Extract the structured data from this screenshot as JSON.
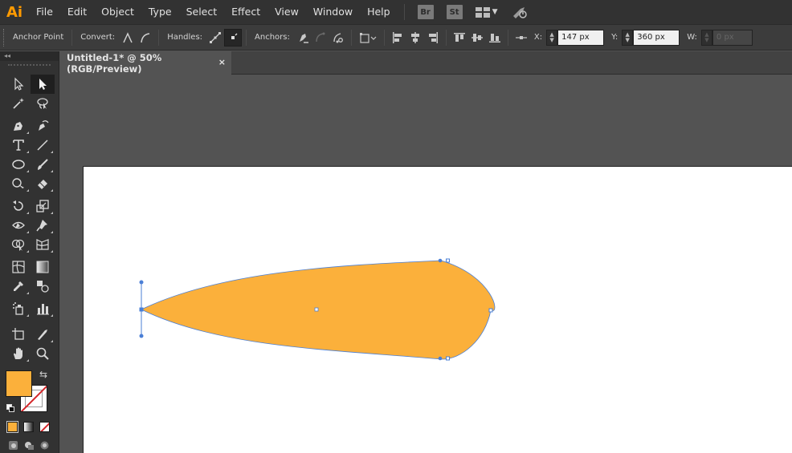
{
  "app": {
    "logo_text": "Ai",
    "accent_color": "#ff9a00"
  },
  "menu": {
    "items": [
      "File",
      "Edit",
      "Object",
      "Type",
      "Select",
      "Effect",
      "View",
      "Window",
      "Help"
    ],
    "bridge_label": "Br",
    "stock_label": "St"
  },
  "control_bar": {
    "selection_label": "Anchor Point",
    "convert_label": "Convert:",
    "handles_label": "Handles:",
    "anchors_label": "Anchors:",
    "x_label": "X:",
    "x_value": "147 px",
    "y_label": "Y:",
    "y_value": "360 px",
    "w_label": "W:",
    "w_value": "0 px"
  },
  "document": {
    "tab_title": "Untitled-1* @ 50% (RGB/Preview)",
    "close_glyph": "×"
  },
  "tools_panel": {
    "collapse_glyph": "◂◂",
    "fill_color": "#fbb03b",
    "stroke_color": "none"
  },
  "artwork": {
    "shape_fill": "#fbb03b",
    "path_color": "#4a7fd6"
  }
}
